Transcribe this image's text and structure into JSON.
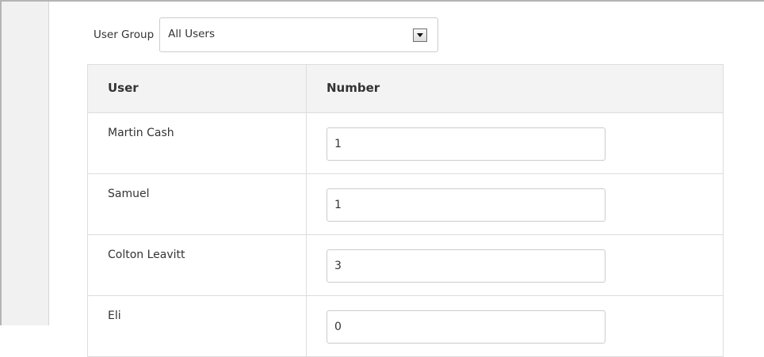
{
  "filter": {
    "label": "User Group",
    "selected": "All Users"
  },
  "table": {
    "headers": [
      "User",
      "Number"
    ],
    "rows": [
      {
        "user": "Martin Cash",
        "number": "1"
      },
      {
        "user": "Samuel",
        "number": "1"
      },
      {
        "user": "Colton Leavitt",
        "number": "3"
      },
      {
        "user": "Eli",
        "number": "0"
      }
    ]
  },
  "icons": {
    "select_arrow": "chevron-down-icon"
  }
}
